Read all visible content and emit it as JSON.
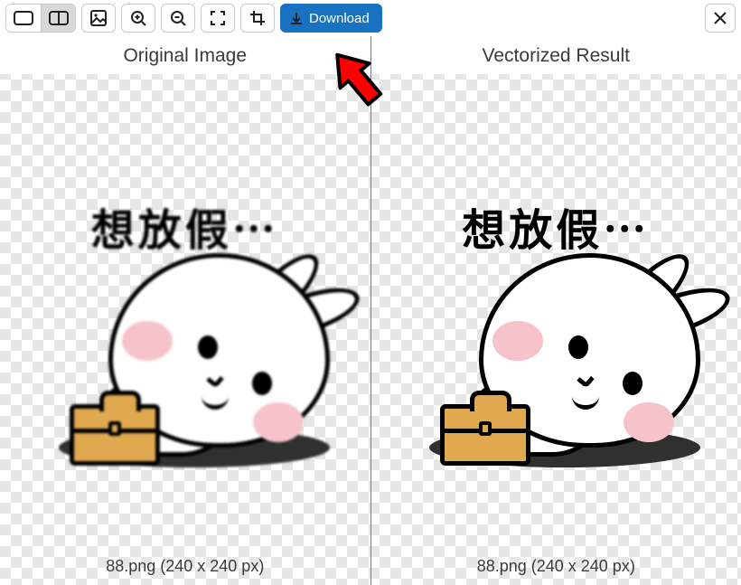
{
  "toolbar": {
    "download_label": "Download"
  },
  "panels": {
    "left": {
      "title": "Original Image",
      "caption": "88.png (240 x 240 px)",
      "art_text": "想放假⋯"
    },
    "right": {
      "title": "Vectorized Result",
      "caption": "88.png (240 x 240 px)",
      "art_text": "想放假⋯"
    }
  },
  "appearance": {
    "accent": "#1971c2",
    "briefcase_color": "#e0a94f",
    "cheek_color": "#f6c3cb"
  }
}
